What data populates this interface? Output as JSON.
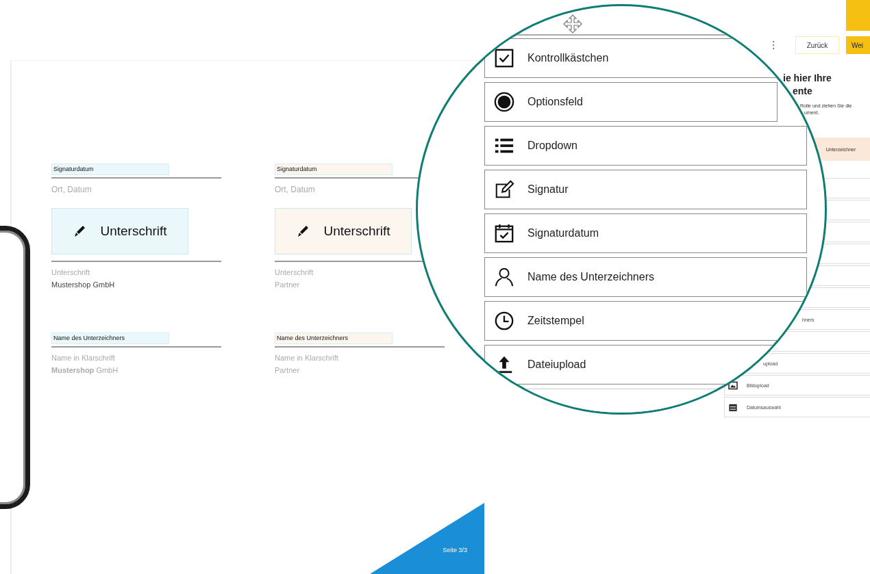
{
  "document": {
    "signers": [
      {
        "color": "#eaf8fb",
        "date_field": "Signaturdatum",
        "date_caption": "Ort, Datum",
        "signature_button": "Unterschrift",
        "signature_caption": "Unterschrift",
        "signature_party": "Mustershop GmbH",
        "name_field": "Name des Unterzeichners",
        "name_caption": "Name in Klarschrift",
        "name_party": "**Mustershop** GmbH"
      },
      {
        "color": "#fdf6ee",
        "date_field": "Signaturdatum",
        "date_caption": "Ort, Datum",
        "signature_button": "Unterschrift",
        "signature_caption": "Unterschrift",
        "signature_party": "Partner",
        "name_field": "Name des Unterzeichners",
        "name_caption": "Name in Klarschrift",
        "name_party": "Partner"
      }
    ],
    "page_label": "Seite 3/3"
  },
  "toolbar": {
    "buttons": [
      {
        "label": "Zurück",
        "kind": "secondary"
      },
      {
        "label": "Wei",
        "kind": "primary"
      }
    ]
  },
  "panel": {
    "heading_lines": [
      "ie hier Ihre",
      "ente"
    ],
    "description_lines": [
      "Rolle und ziehen Sie die",
      "ument."
    ],
    "role_tab": "Unterzeichner",
    "elements": [
      {
        "label": "hners",
        "kind": "plain"
      },
      {
        "label": "upload",
        "kind": "plain"
      },
      {
        "label": "Bildupload",
        "kind": "image"
      },
      {
        "label": "Datumsauswahl",
        "kind": "calendar"
      }
    ]
  },
  "magnifier": {
    "elements": [
      {
        "label": "Kontrollkästchen",
        "kind": "checkbox"
      },
      {
        "label": "Optionsfeld",
        "kind": "radio"
      },
      {
        "label": "Dropdown",
        "kind": "list"
      },
      {
        "label": "Signatur",
        "kind": "signature"
      },
      {
        "label": "Signaturdatum",
        "kind": "date"
      },
      {
        "label": "Name des Unterzeichners",
        "kind": "person"
      },
      {
        "label": "Zeitstempel",
        "kind": "clock"
      },
      {
        "label": "Dateiupload",
        "kind": "upload"
      }
    ]
  }
}
